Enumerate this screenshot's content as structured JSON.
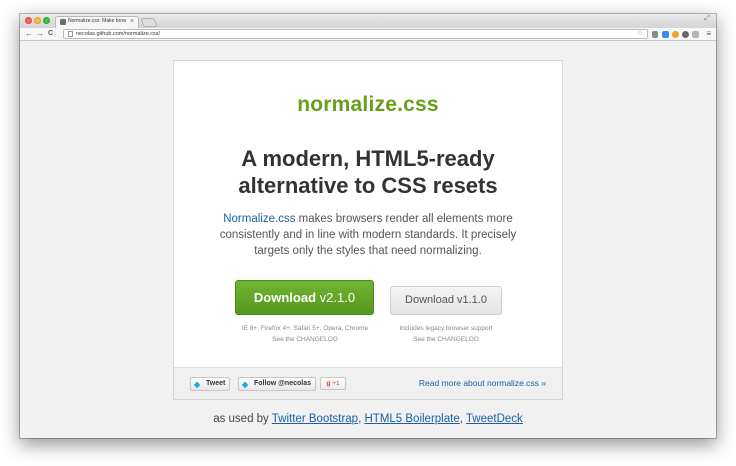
{
  "browser": {
    "tab_title": "Normalize.css: Make brow",
    "tab_close": "×",
    "resize_glyph": "⤢",
    "url": "necolas.github.com/normalize.css/",
    "back": "←",
    "forward": "→",
    "reload": "C",
    "star": "☆",
    "menu": "≡",
    "extension_icons": [
      "wrench-icon",
      "blue-tag-icon",
      "orange-extension-icon",
      "gray-circle-icon",
      "puzzle-icon"
    ]
  },
  "page": {
    "brand": "normalize.css",
    "headline_line1": "A modern, HTML5-ready",
    "headline_line2": "alternative to CSS resets",
    "intro_link": "Normalize.css",
    "intro_line1_rest": " makes browsers render all elements more",
    "intro_line2": "consistently and in line with modern standards. It precisely",
    "intro_line3": "targets only the styles that need normalizing.",
    "download_primary_bold": "Download",
    "download_primary_version": " v2.1.0",
    "download_secondary": "Download v1.1.0",
    "primary_note": "IE 8+, Firefox 4+, Safari 5+, Opera, Chrome",
    "secondary_note": "Includes legacy browser support",
    "changelog_link": "See the CHANGELOG",
    "tweet": "Tweet",
    "follow": "Follow @necolas",
    "gplus": "+1",
    "read_more": "Read more about normalize.css »",
    "used_by_prefix": "as used by ",
    "used_by_1": "Twitter Bootstrap",
    "used_by_sep1": ", ",
    "used_by_2": "HTML5 Boilerplate",
    "used_by_sep2": ", ",
    "used_by_3": "TweetDeck"
  },
  "colors": {
    "brand_green": "#68a019",
    "link_blue": "#1d5fa3",
    "button_green": "#5ea524"
  }
}
